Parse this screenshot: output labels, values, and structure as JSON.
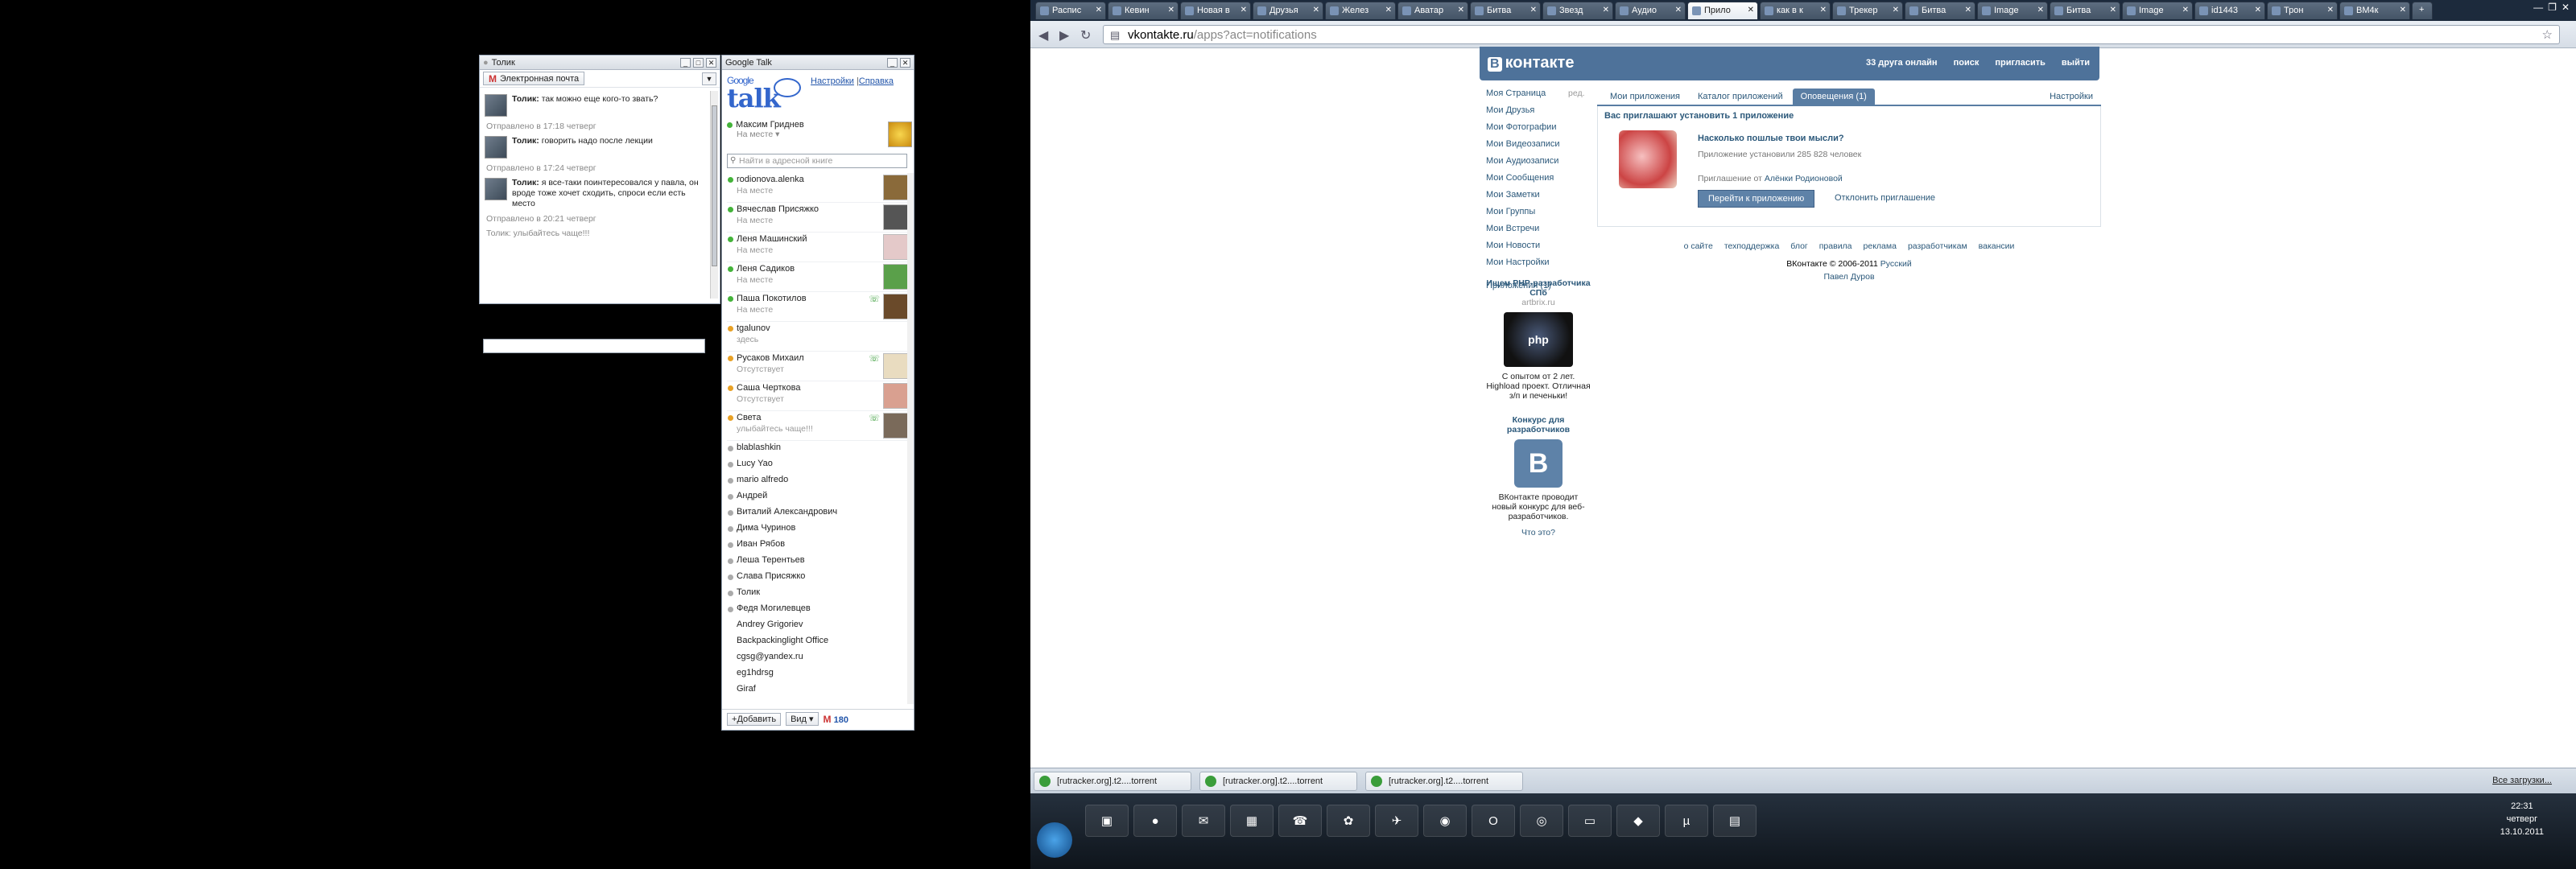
{
  "chat": {
    "title": "Толик",
    "email_button": "Электронная почта",
    "messages": [
      {
        "author": "Толик:",
        "text": "так можно еще кого-то звать?"
      },
      {
        "author": "Толик:",
        "text": "говорить надо после лекции"
      },
      {
        "author": "Толик:",
        "text": "я все-таки поинтересовался у павла, он вроде тоже хочет сходить, спроси если есть место"
      }
    ],
    "sent": [
      "Отправлено в 17:18 четверг",
      "Отправлено в 17:24 четверг",
      "Отправлено в 20:21 четверг"
    ],
    "last_status": "Толик: улыбайтесь чаще!!!"
  },
  "gtalk": {
    "title": "Google Talk",
    "logo_small": "Google",
    "logo": "talk",
    "links": {
      "settings": "Настройки",
      "sep": "|",
      "help": "Справка"
    },
    "me": {
      "name": "Максим Гриднев",
      "status": "На месте ▾"
    },
    "search_placeholder": "Найти в адресной книге",
    "contacts": [
      {
        "name": "rodionova.alenka",
        "status": "На месте",
        "dot": "green",
        "av": "#8a6a3a"
      },
      {
        "name": "Вячеслав Присяжко",
        "status": "На месте",
        "dot": "green",
        "av": "#555"
      },
      {
        "name": "Леня Машинский",
        "status": "На месте",
        "dot": "green",
        "av": "#e4c9c9"
      },
      {
        "name": "Леня Садиков",
        "status": "На месте",
        "dot": "green",
        "av": "#5aa04a"
      },
      {
        "name": "Паша Покотилов",
        "status": "На месте",
        "dot": "green",
        "av": "#6a4a2a",
        "phone": true
      },
      {
        "name": "tgalunov",
        "status": "здесь",
        "dot": "orange",
        "av": ""
      },
      {
        "name": "Русаков Михаил",
        "status": "Отсутствует",
        "dot": "orange",
        "av": "#e9dcc0",
        "phone": true
      },
      {
        "name": "Саша Черткова",
        "status": "Отсутствует",
        "dot": "orange",
        "av": "#d9a090"
      },
      {
        "name": "Света",
        "status": "улыбайтесь чаще!!!",
        "dot": "orange",
        "av": "#7a6a5a",
        "phone": true
      }
    ],
    "offline": [
      "blablashkin",
      "Lucy Yao",
      "mario alfredo",
      "Андрей",
      "Виталий Александрович",
      "Дима Чуринов",
      "Иван Рябов",
      "Леша Терентьев",
      "Слава Присяжко",
      "Толик",
      "Федя Могилевцев"
    ],
    "others": [
      "Andrey Grigoriev",
      "Backpackinglight Office",
      "cgsg@yandex.ru",
      "eg1hdrsg",
      "Giraf"
    ],
    "add_button": "Добавить",
    "view_button": "Вид ▾",
    "mail_count": "180"
  },
  "browser": {
    "tabs": [
      "Распис",
      "Кевин",
      "Новая в",
      "Друзья",
      "Желез",
      "Аватар",
      "Битва",
      "Звезд",
      "Аудио",
      "Прило",
      "как в к",
      "Трекер",
      "Битва",
      "Image",
      "Битва",
      "Image",
      "id1443",
      "Трон",
      "ВМ4к"
    ],
    "active_tab_index": 9,
    "url_host": "vkontakte.ru",
    "url_path": "/apps?act=notifications"
  },
  "vk": {
    "logo_b": "В",
    "logo": "контакте",
    "header_links": [
      "33 друга онлайн",
      "поиск",
      "пригласить",
      "выйти"
    ],
    "menu": [
      "Моя Страница",
      "Мои Друзья",
      "Мои Фотографии",
      "Мои Видеозаписи",
      "Мои Аудиозаписи",
      "Мои Сообщения",
      "Мои Заметки",
      "Мои Группы",
      "Мои Встречи",
      "Мои Новости",
      "Мои Настройки",
      "Приложения (1)"
    ],
    "edit": "ред.",
    "tabs": [
      "Мои приложения",
      "Каталог приложений",
      "Оповещения (1)",
      "Настройки"
    ],
    "invite_header": "Вас приглашают установить 1 приложение",
    "app_title": "Насколько пошлые твои мысли?",
    "app_installs": "Приложение установили 285 828 человек",
    "invite_from_label": "Приглашение от",
    "invite_from": "Алёнки Родионовой",
    "go_button": "Перейти к приложению",
    "decline": "Отклонить приглашение",
    "footer_links": [
      "о сайте",
      "техподдержка",
      "блог",
      "правила",
      "реклама",
      "разработчикам",
      "вакансии"
    ],
    "copyright": "ВКонтакте © 2006-2011",
    "lang": "Русский",
    "author": "Павел Дуров",
    "ad1_title": "Ищем PHP-разработчика СПб",
    "ad1_site": "artbrix.ru",
    "ad1_img": "php",
    "ad1_text": "С опытом от 2 лет. Highload проект. Отличная з/п и печеньки!",
    "ad2_title": "Конкурс для разработчиков",
    "ad2_text": "ВКонтакте проводит новый конкурс для веб-разработчиков.",
    "ad_what": "Что это?"
  },
  "downloads": {
    "items": [
      "[rutracker.org].t2....torrent",
      "[rutracker.org].t2....torrent",
      "[rutracker.org].t2....torrent"
    ],
    "all": "Все загрузки..."
  },
  "taskbar": {
    "time": "22:31",
    "day": "четверг",
    "date": "13.10.2011"
  }
}
